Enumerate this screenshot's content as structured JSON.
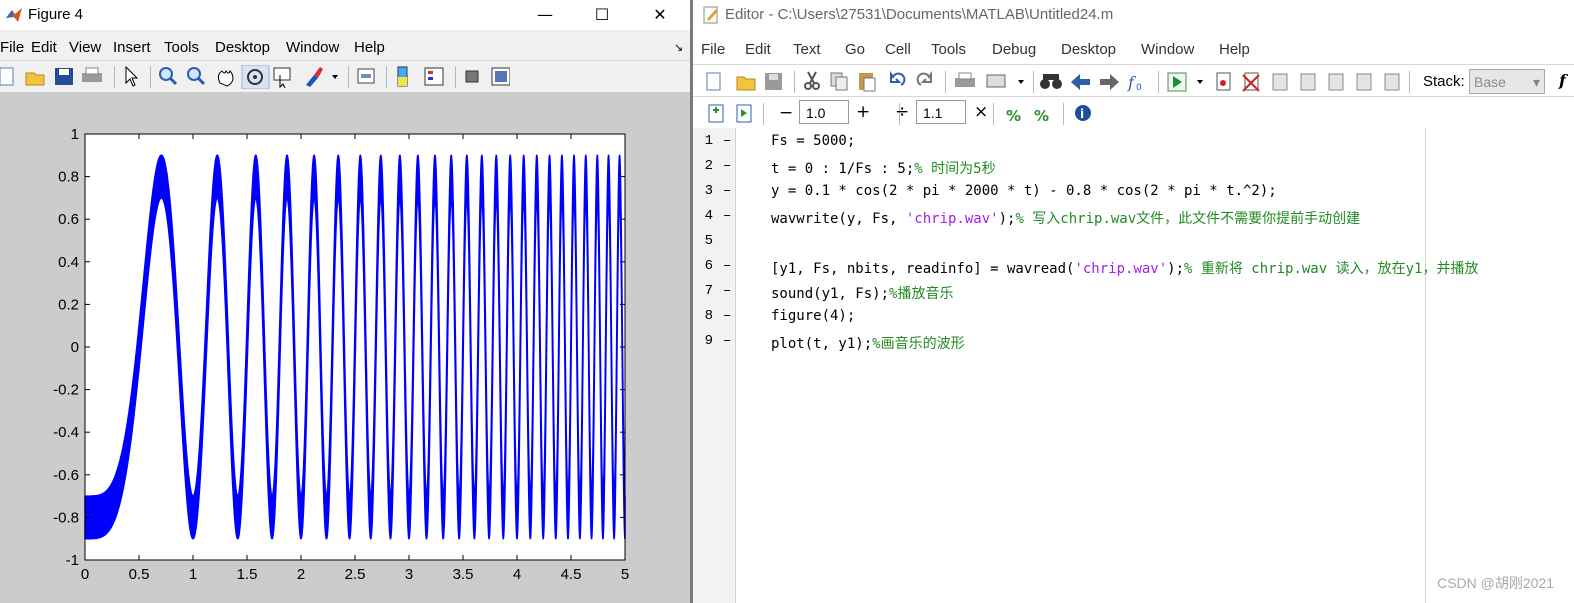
{
  "figure": {
    "title": "Figure 4",
    "menu": [
      "File",
      "Edit",
      "View",
      "Insert",
      "Tools",
      "Desktop",
      "Window",
      "Help"
    ],
    "toolbar_icons": [
      "new-icon",
      "open-icon",
      "save-icon",
      "print-icon",
      "pointer-icon",
      "zoom-in-icon",
      "zoom-out-icon",
      "pan-icon",
      "rotate-icon",
      "data-cursor-icon",
      "brush-icon",
      "dropdown-arrow-icon",
      "link-icon",
      "colorbar-icon",
      "legend-icon",
      "hide-plot-tools-icon",
      "show-plot-tools-icon"
    ]
  },
  "chart_data": {
    "type": "line",
    "title": "",
    "xlabel": "",
    "ylabel": "",
    "xlim": [
      0,
      5
    ],
    "ylim": [
      -1,
      1
    ],
    "xticks": [
      "0",
      "0.5",
      "1",
      "1.5",
      "2",
      "2.5",
      "3",
      "3.5",
      "4",
      "4.5",
      "5"
    ],
    "yticks": [
      "1",
      "0.8",
      "0.6",
      "0.4",
      "0.2",
      "0",
      "-0.2",
      "-0.4",
      "-0.6",
      "-0.8",
      "-1"
    ],
    "series": [
      {
        "name": "",
        "color": "#0000ff",
        "function": "0.1*cos(2*pi*2000*t) - 0.8*cos(2*pi*t^2)",
        "sample_rate": 5000,
        "t_range": [
          0,
          5
        ]
      }
    ],
    "grid": false
  },
  "editor": {
    "title": "Editor - C:\\Users\\27531\\Documents\\MATLAB\\Untitled24.m",
    "menu": [
      "File",
      "Edit",
      "Text",
      "Go",
      "Cell",
      "Tools",
      "Debug",
      "Desktop",
      "Window",
      "Help"
    ],
    "stack_label": "Stack:",
    "stack_value": "Base",
    "cell_minus": "−",
    "cell_value1": "1.0",
    "cell_plus": "+",
    "cell_div": "÷",
    "cell_value2": "1.1",
    "cell_times": "×",
    "lines": [
      {
        "n": "1",
        "dash": "–",
        "parts": [
          {
            "t": "Fs = 5000;",
            "c": ""
          }
        ]
      },
      {
        "n": "2",
        "dash": "–",
        "parts": [
          {
            "t": "t = 0 : 1/Fs : 5;",
            "c": ""
          },
          {
            "t": "% 时间为5秒",
            "c": "cmt"
          }
        ]
      },
      {
        "n": "3",
        "dash": "–",
        "parts": [
          {
            "t": "y = 0.1 * cos(2 * pi * 2000 * t) - 0.8 * cos(2 * pi * t.^2);",
            "c": ""
          }
        ]
      },
      {
        "n": "4",
        "dash": "–",
        "parts": [
          {
            "t": "wavwrite(y, Fs, ",
            "c": ""
          },
          {
            "t": "'chrip.wav'",
            "c": "str"
          },
          {
            "t": ");",
            "c": ""
          },
          {
            "t": "% 写入chrip.wav文件，此文件不需要你提前手动创建",
            "c": "cmt"
          }
        ]
      },
      {
        "n": "5",
        "dash": "",
        "parts": []
      },
      {
        "n": "6",
        "dash": "–",
        "parts": [
          {
            "t": "[y1, Fs, nbits, readinfo] = wavread(",
            "c": ""
          },
          {
            "t": "'chrip.wav'",
            "c": "str"
          },
          {
            "t": ");",
            "c": ""
          },
          {
            "t": "% 重新将 chrip.wav 读入，放在y1，并播放",
            "c": "cmt"
          }
        ]
      },
      {
        "n": "7",
        "dash": "–",
        "parts": [
          {
            "t": "sound(y1, Fs);",
            "c": ""
          },
          {
            "t": "%播放音乐",
            "c": "cmt"
          }
        ]
      },
      {
        "n": "8",
        "dash": "–",
        "parts": [
          {
            "t": "figure(4);",
            "c": ""
          }
        ]
      },
      {
        "n": "9",
        "dash": "–",
        "parts": [
          {
            "t": "plot(t, y1);",
            "c": ""
          },
          {
            "t": "%画音乐的波形",
            "c": "cmt"
          }
        ]
      }
    ]
  },
  "watermark": "CSDN @胡刚2021"
}
